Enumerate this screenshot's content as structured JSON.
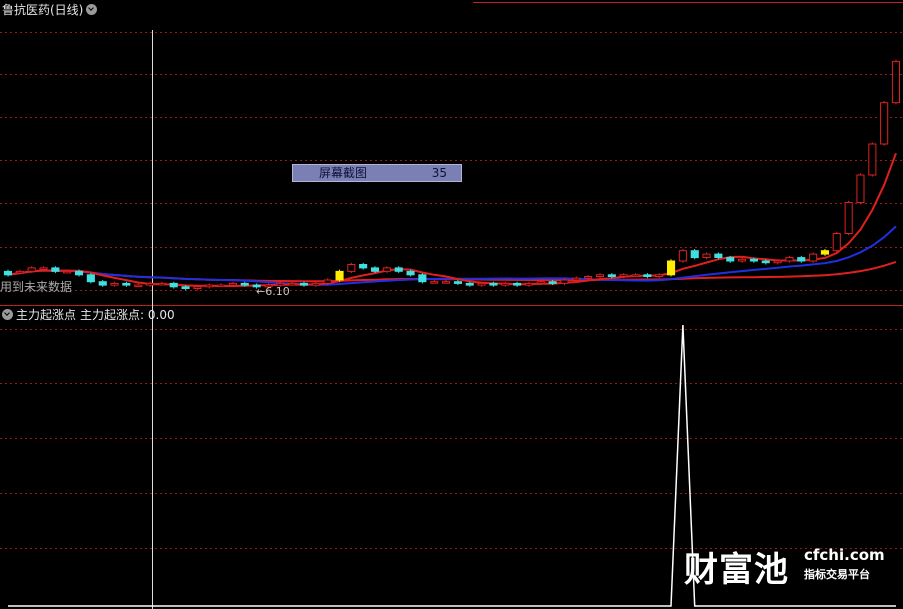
{
  "main_panel": {
    "title": "鲁抗医药(日线)",
    "future_data_label": "用到未来数据",
    "price_marker": "6.10"
  },
  "sub_panel": {
    "indicator_name": "主力起涨点",
    "value_label": "主力起涨点: 0.00"
  },
  "screenshot_box": {
    "label": "屏幕截图",
    "number": "35"
  },
  "watermark": {
    "brand": "财富池",
    "domain": "cfchi.com",
    "tagline": "指标交易平台"
  },
  "colors": {
    "background": "#000000",
    "grid": "#9a1a1a",
    "up": "#e02020",
    "down": "#40e0e0",
    "highlight": "#ffee00",
    "ma_red": "#e02020",
    "ma_blue": "#2030e0",
    "indicator": "#ffffff"
  },
  "chart_data": [
    {
      "type": "candlestick",
      "series": [
        {
          "name": "price",
          "values": [
            [
              6.6,
              6.5
            ],
            [
              6.6,
              6.6
            ],
            [
              6.6,
              6.7
            ],
            [
              6.7,
              6.7
            ],
            [
              6.7,
              6.6
            ],
            [
              6.6,
              6.6
            ],
            [
              6.6,
              6.5
            ],
            [
              6.5,
              6.3
            ],
            [
              6.3,
              6.2
            ],
            [
              6.2,
              6.25
            ],
            [
              6.25,
              6.2
            ],
            [
              6.2,
              6.2
            ],
            [
              6.2,
              6.25
            ],
            [
              6.25,
              6.25
            ],
            [
              6.25,
              6.15
            ],
            [
              6.15,
              6.1
            ],
            [
              6.1,
              6.15
            ],
            [
              6.15,
              6.2
            ],
            [
              6.2,
              6.2
            ],
            [
              6.2,
              6.25
            ],
            [
              6.25,
              6.2
            ],
            [
              6.2,
              6.15
            ],
            [
              6.15,
              6.2
            ],
            [
              6.2,
              6.25
            ],
            [
              6.25,
              6.25
            ],
            [
              6.25,
              6.2
            ],
            [
              6.2,
              6.25
            ],
            [
              6.25,
              6.35
            ],
            [
              6.35,
              6.6
            ],
            [
              6.6,
              6.8
            ],
            [
              6.8,
              6.7
            ],
            [
              6.7,
              6.6
            ],
            [
              6.6,
              6.7
            ],
            [
              6.7,
              6.6
            ],
            [
              6.6,
              6.5
            ],
            [
              6.5,
              6.3
            ],
            [
              6.3,
              6.3
            ],
            [
              6.3,
              6.3
            ],
            [
              6.3,
              6.25
            ],
            [
              6.25,
              6.2
            ],
            [
              6.2,
              6.25
            ],
            [
              6.25,
              6.2
            ],
            [
              6.2,
              6.25
            ],
            [
              6.25,
              6.2
            ],
            [
              6.2,
              6.25
            ],
            [
              6.25,
              6.3
            ],
            [
              6.3,
              6.25
            ],
            [
              6.25,
              6.35
            ],
            [
              6.35,
              6.4
            ],
            [
              6.4,
              6.45
            ],
            [
              6.45,
              6.5
            ],
            [
              6.5,
              6.45
            ],
            [
              6.45,
              6.5
            ],
            [
              6.5,
              6.5
            ],
            [
              6.5,
              6.45
            ],
            [
              6.45,
              6.5
            ],
            [
              6.5,
              6.9
            ],
            [
              6.9,
              7.2
            ],
            [
              7.2,
              7.0
            ],
            [
              7.0,
              7.1
            ],
            [
              7.1,
              7.0
            ],
            [
              7.0,
              6.9
            ],
            [
              6.9,
              6.95
            ],
            [
              6.95,
              6.9
            ],
            [
              6.9,
              6.85
            ],
            [
              6.85,
              6.9
            ],
            [
              6.9,
              7.0
            ],
            [
              7.0,
              6.9
            ],
            [
              6.9,
              7.1
            ],
            [
              7.1,
              7.2
            ],
            [
              7.2,
              7.7
            ],
            [
              7.7,
              8.6
            ],
            [
              8.6,
              9.4
            ],
            [
              9.4,
              10.3
            ],
            [
              10.3,
              11.5
            ],
            [
              11.5,
              12.7
            ]
          ]
        }
      ]
    },
    {
      "type": "line",
      "title": "主力起涨点",
      "series": [
        {
          "name": "主力起涨点",
          "values": [
            0,
            0,
            0,
            0,
            0,
            0,
            0,
            0,
            0,
            0,
            0,
            0,
            0,
            0,
            0,
            0,
            0,
            0,
            0,
            0,
            0,
            0,
            0,
            0,
            0,
            0,
            0,
            0,
            0,
            0,
            0,
            0,
            0,
            0,
            0,
            0,
            0,
            0,
            0,
            0,
            0,
            0,
            0,
            0,
            0,
            0,
            0,
            0,
            0,
            0,
            0,
            0,
            0,
            0,
            0,
            0,
            0,
            1,
            0,
            0,
            0,
            0,
            0,
            0,
            0,
            0,
            0,
            0,
            0,
            0,
            0,
            0,
            0,
            0,
            0,
            0
          ]
        }
      ]
    }
  ]
}
